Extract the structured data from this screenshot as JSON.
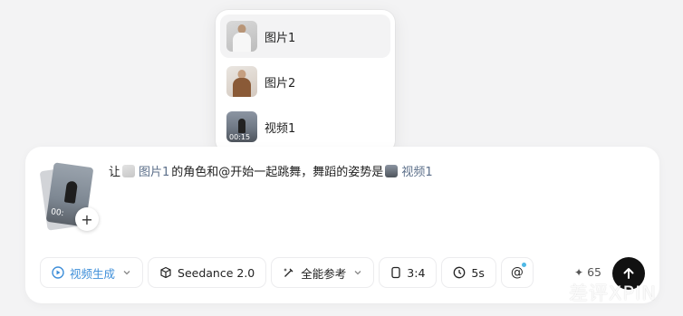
{
  "menu": {
    "items": [
      {
        "label": "图片1",
        "thumb": "person-white-shirt"
      },
      {
        "label": "图片2",
        "thumb": "person-brown-sweater"
      },
      {
        "label": "视频1",
        "thumb": "video-person",
        "duration": "00:15"
      }
    ]
  },
  "reference_stack": {
    "thumb_label": "00:",
    "add_icon": "plus-icon"
  },
  "prompt": {
    "prefix": "让",
    "chip1": "图片1",
    "middle": "的角色和@开始一起跳舞，舞蹈的姿势是",
    "chip2": "视频1"
  },
  "toolbar": {
    "mode_label": "视频生成",
    "model_label": "Seedance 2.0",
    "reference_label": "全能参考",
    "ratio_label": "3:4",
    "duration_label": "5s",
    "mention_label": "@",
    "credits": "65",
    "accent_color": "#3f8fd9"
  },
  "watermark": "差评XPIN"
}
